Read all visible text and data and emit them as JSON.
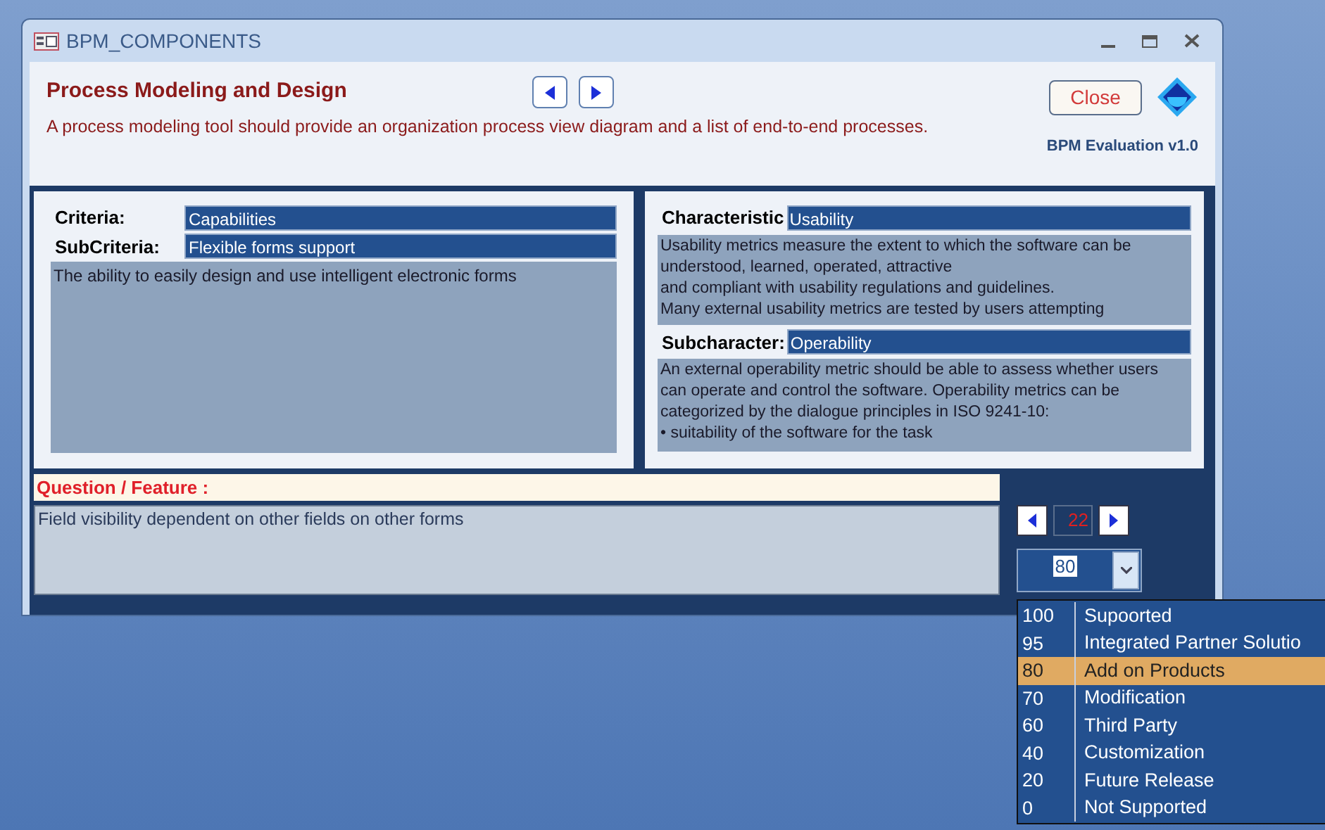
{
  "window": {
    "title": "BPM_COMPONENTS"
  },
  "header": {
    "title": "Process Modeling and Design",
    "description": "A process modeling tool should provide an organization process view diagram and a list of end-to-end processes.",
    "close_button": "Close",
    "version": "BPM Evaluation v1.0"
  },
  "criteria_panel": {
    "criteria_label": "Criteria:",
    "criteria": "Capabilities",
    "subcriteria_label": "SubCriteria:",
    "subcriteria": "Flexible forms support",
    "description": "The ability to easily design and use intelligent electronic forms"
  },
  "characteristic_panel": {
    "characteristic_label": "Characteristic",
    "characteristic": "Usability",
    "characteristic_description": [
      "Usability metrics measure the extent to which the software can be understood, learned, operated, attractive",
      "and compliant with usability regulations and guidelines.",
      "Many external usability metrics are tested by users attempting"
    ],
    "subcharacter_label": "Subcharacter:",
    "subcharacter": "Operability",
    "subcharacter_description": [
      "An external operability metric should be able to assess whether users can operate and control the software. Operability metrics can be categorized by the dialogue principles in ISO 9241-10:",
      "• suitability of the software for the task"
    ]
  },
  "question": {
    "label": "Question / Feature :",
    "text": "Field visibility dependent on other fields on other forms"
  },
  "record_counter": "22",
  "score_combo": {
    "value": "80",
    "expanded": true
  },
  "score_options": [
    {
      "score": "100",
      "label": "Supoorted",
      "selected": false
    },
    {
      "score": "95",
      "label": "Integrated Partner Solutio",
      "selected": false
    },
    {
      "score": "80",
      "label": "Add on Products",
      "selected": true
    },
    {
      "score": "70",
      "label": "Modification",
      "selected": false
    },
    {
      "score": "60",
      "label": "Third Party",
      "selected": false
    },
    {
      "score": "40",
      "label": "Customization",
      "selected": false
    },
    {
      "score": "20",
      "label": "Future Release",
      "selected": false
    },
    {
      "score": "0",
      "label": "Not Supported",
      "selected": false
    }
  ]
}
